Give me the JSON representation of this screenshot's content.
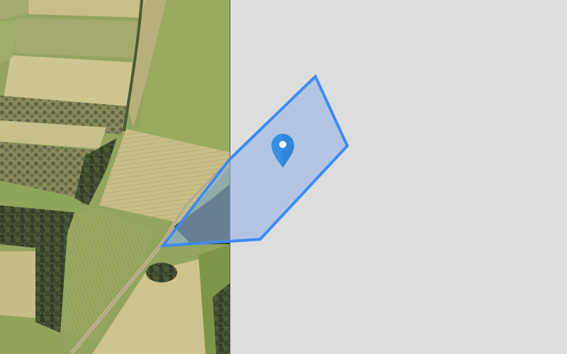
{
  "map": {
    "view": "satellite",
    "tile_coverage": "partial",
    "missing_tile_color": "#dddddd"
  },
  "colors": {
    "polygon_stroke": "#3d8bf5",
    "polygon_fill": "#8fb0e8",
    "marker_fill": "#2f86d6",
    "marker_center": "#ffffff",
    "field_green": "#8da35a",
    "field_tan": "#c9bf86",
    "forest_dark": "#3c4a2c",
    "road": "#b9b08e"
  },
  "overlays": {
    "area_polygon": "drawn-area",
    "marker_icon": "map-pin-icon"
  }
}
